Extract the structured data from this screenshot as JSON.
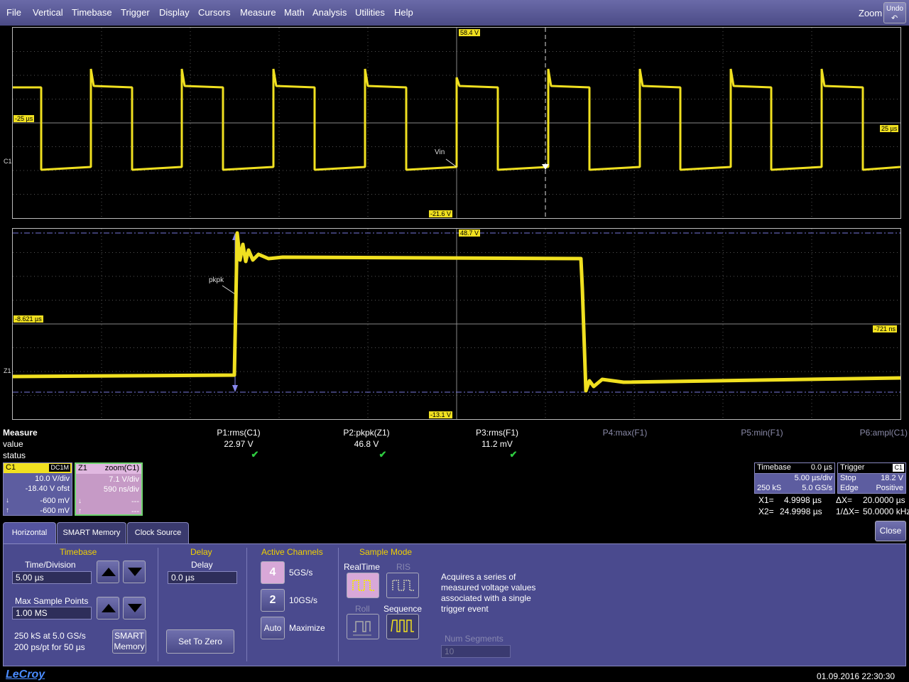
{
  "menu": {
    "items": [
      "File",
      "Vertical",
      "Timebase",
      "Trigger",
      "Display",
      "Cursors",
      "Measure",
      "Math",
      "Analysis",
      "Utilities",
      "Help"
    ],
    "zoom": "Zoom",
    "undo": "Undo"
  },
  "grid1": {
    "top_level": "58.4 V",
    "bottom_level": "-21.6 V",
    "left_time": "-25 µs",
    "right_time": "25 µs",
    "trace_label": "C1",
    "annotation": "Vin"
  },
  "grid2": {
    "top_level": "48.7 V",
    "bottom_level": "-13.1 V",
    "left_time": "-8.621 µs",
    "right_time": "-721 ns",
    "trace_label": "Z1",
    "annotation": "pkpk"
  },
  "measure": {
    "title": "Measure",
    "row_value": "value",
    "row_status": "status",
    "params": [
      {
        "name": "P1:rms(C1)",
        "value": "22.97 V",
        "status": "✔",
        "active": true
      },
      {
        "name": "P2:pkpk(Z1)",
        "value": "46.8 V",
        "status": "✔",
        "active": true
      },
      {
        "name": "P3:rms(F1)",
        "value": "11.2 mV",
        "status": "✔",
        "active": true
      },
      {
        "name": "P4:max(F1)",
        "value": "",
        "status": "",
        "active": false
      },
      {
        "name": "P5:min(F1)",
        "value": "",
        "status": "",
        "active": false
      },
      {
        "name": "P6:ampl(C1)",
        "value": "",
        "status": "",
        "active": false
      }
    ]
  },
  "c1": {
    "name": "C1",
    "coupling": "DC1M",
    "vdiv": "10.0 V/div",
    "offset": "-18.40 V ofst",
    "line1": "-600 mV",
    "line2": "-600 mV"
  },
  "z1": {
    "name": "Z1",
    "source": "zoom(C1)",
    "vdiv": "7.1 V/div",
    "tdiv": "590 ns/div",
    "line1": "---",
    "line2": "---"
  },
  "timebase_desc": {
    "title": "Timebase",
    "delay": "0.0 µs",
    "tdiv": "5.00 µs/div",
    "samples": "250 kS",
    "rate": "5.0 GS/s"
  },
  "trigger_desc": {
    "title": "Trigger",
    "source": "C1",
    "mode": "Stop",
    "level": "18.2 V",
    "type": "Edge",
    "slope": "Positive"
  },
  "cursors": {
    "x1_label": "X1=",
    "x1": "4.9998 µs",
    "dx_label": "ΔX=",
    "dx": "20.0000 µs",
    "x2_label": "X2=",
    "x2": "24.9998 µs",
    "inv_label": "1/ΔX=",
    "inv": "50.0000 kHz"
  },
  "tabs": [
    "Horizontal",
    "SMART Memory",
    "Clock Source"
  ],
  "close": "Close",
  "horizontal": {
    "timebase_title": "Timebase",
    "time_div_label": "Time/Division",
    "time_div": "5.00 µs",
    "max_sample_label": "Max Sample Points",
    "max_sample": "1.00 MS",
    "info1": "250 kS at 5.0 GS/s",
    "info2": "200 ps/pt for 50 µs",
    "smart_btn1": "SMART",
    "smart_btn2": "Memory",
    "delay_title": "Delay",
    "delay_label": "Delay",
    "delay": "0.0 µs",
    "set_zero": "Set To Zero",
    "active_title": "Active Channels",
    "ch4": "4",
    "ch4_rate": "5GS/s",
    "ch2": "2",
    "ch2_rate": "10GS/s",
    "auto": "Auto",
    "maximize": "Maximize",
    "sample_title": "Sample Mode",
    "realtime": "RealTime",
    "ris": "RIS",
    "roll": "Roll",
    "sequence": "Sequence",
    "desc1": "Acquires a series of",
    "desc2": "measured voltage values",
    "desc3": "associated with a single",
    "desc4": "trigger event",
    "num_seg_label": "Num Segments",
    "num_seg": "10"
  },
  "footer": {
    "logo": "LeCroy",
    "datetime": "01.09.2016 22:30:30"
  },
  "colors": {
    "trace": "#f0e020",
    "menu": "#4b4b86",
    "panel": "#4a4a8e",
    "zoom_trace_desc": "#c69ac6"
  }
}
